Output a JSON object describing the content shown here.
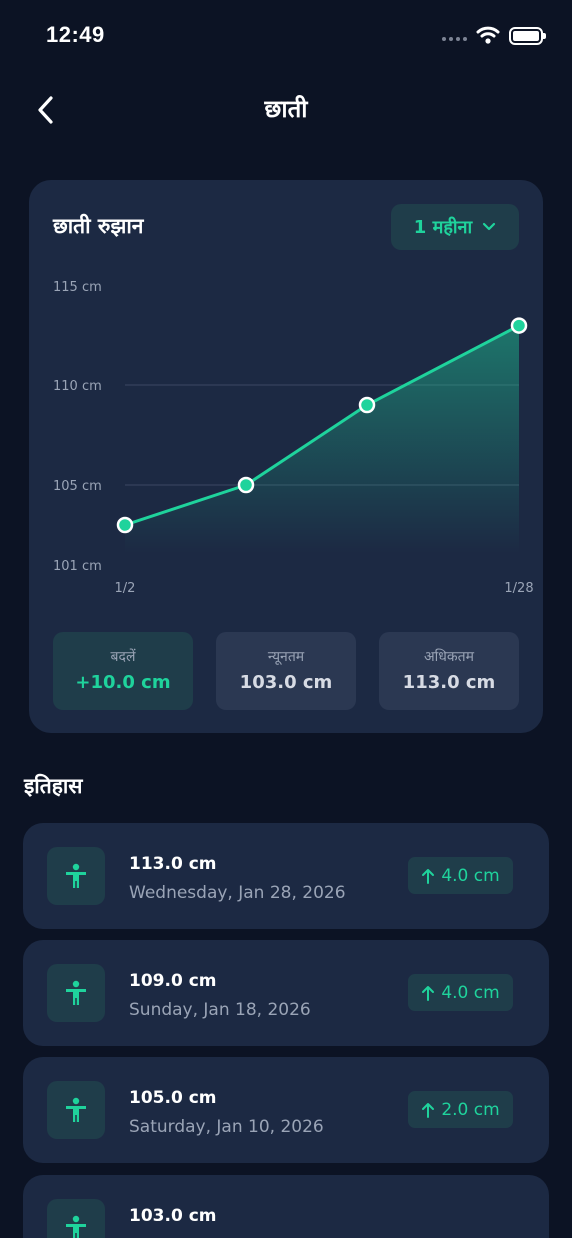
{
  "status_bar": {
    "time": "12:49"
  },
  "header": {
    "title": "छाती",
    "back_icon": "chevron-left-icon"
  },
  "trend": {
    "title": "छाती रुझान",
    "period_label": "1 महीना",
    "period_icon": "chevron-down-icon"
  },
  "chart_data": {
    "type": "area",
    "x": [
      "1/2",
      "1/12",
      "1/20",
      "1/28"
    ],
    "values": [
      103.0,
      105.0,
      109.0,
      113.0
    ],
    "x_tick_labels": [
      "1/2",
      "1/28"
    ],
    "y_ticks": [
      101,
      105,
      110,
      115
    ],
    "y_tick_labels": [
      "101 cm",
      "105 cm",
      "110 cm",
      "115 cm"
    ],
    "ylim": [
      101,
      115
    ],
    "grid": true,
    "line_color": "#1fd39c"
  },
  "stats": [
    {
      "label": "बदलें",
      "value": "+10.0 cm"
    },
    {
      "label": "न्यूनतम",
      "value": "103.0 cm"
    },
    {
      "label": "अधिकतम",
      "value": "113.0 cm"
    }
  ],
  "history": {
    "title": "इतिहास",
    "items": [
      {
        "value": "113.0 cm",
        "date": "Wednesday, Jan 28, 2026",
        "change": "4.0 cm",
        "change_icon": "arrow-up-icon",
        "icon": "body-icon"
      },
      {
        "value": "109.0 cm",
        "date": "Sunday, Jan 18, 2026",
        "change": "4.0 cm",
        "change_icon": "arrow-up-icon",
        "icon": "body-icon"
      },
      {
        "value": "105.0 cm",
        "date": "Saturday, Jan 10, 2026",
        "change": "2.0 cm",
        "change_icon": "arrow-up-icon",
        "icon": "body-icon"
      },
      {
        "value": "103.0 cm",
        "date": "",
        "change": "",
        "icon": "body-icon"
      }
    ]
  },
  "colors": {
    "background": "#0c1324",
    "card": "#1c2943",
    "accent": "#1fd39c",
    "accent_bg": "#1f3d4a"
  }
}
